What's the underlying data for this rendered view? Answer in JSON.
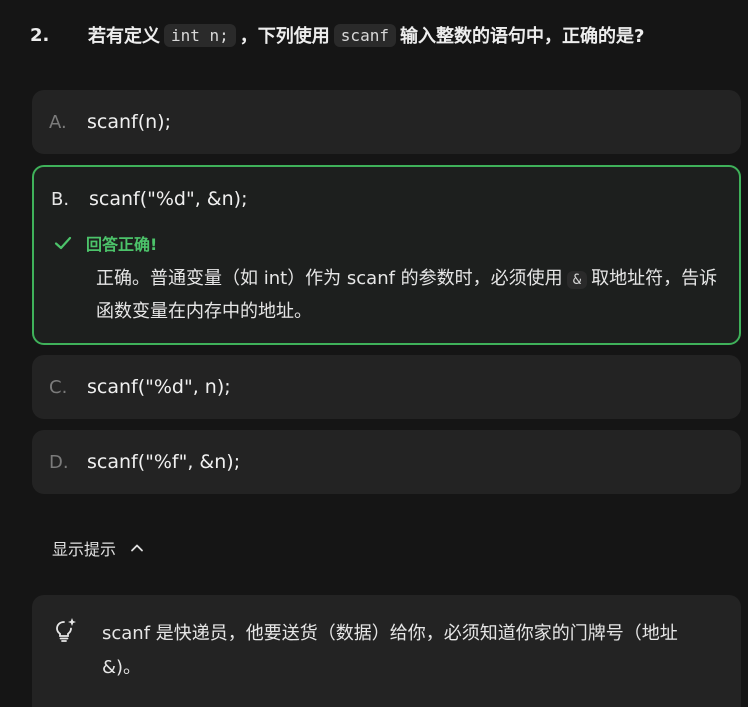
{
  "question": {
    "number": "2.",
    "prefix": "若有定义",
    "code1": "int n;",
    "middle": "，下列使用",
    "code2": "scanf",
    "suffix": "输入整数的语句中，正确的是?"
  },
  "options": [
    {
      "letter": "A.",
      "text": "scanf(n);"
    },
    {
      "letter": "B.",
      "text": "scanf(\"%d\", &n);"
    },
    {
      "letter": "C.",
      "text": "scanf(\"%d\", n);"
    },
    {
      "letter": "D.",
      "text": "scanf(\"%f\", &n);"
    }
  ],
  "feedback": {
    "title": "回答正确!",
    "before_code": "正确。普通变量（如 int）作为 scanf 的参数时，必须使用",
    "code": "&",
    "after_code": "取地址符，告诉函数变量在内存中的地址。",
    "accent": "#3fb15a"
  },
  "hint_toggle": {
    "label": "显示提示",
    "icon": "chevron-up-icon"
  },
  "hint": {
    "icon": "lightbulb-sparkle-icon",
    "text": "scanf 是快递员，他要送货（数据）给你，必须知道你家的门牌号（地址 &)。"
  }
}
